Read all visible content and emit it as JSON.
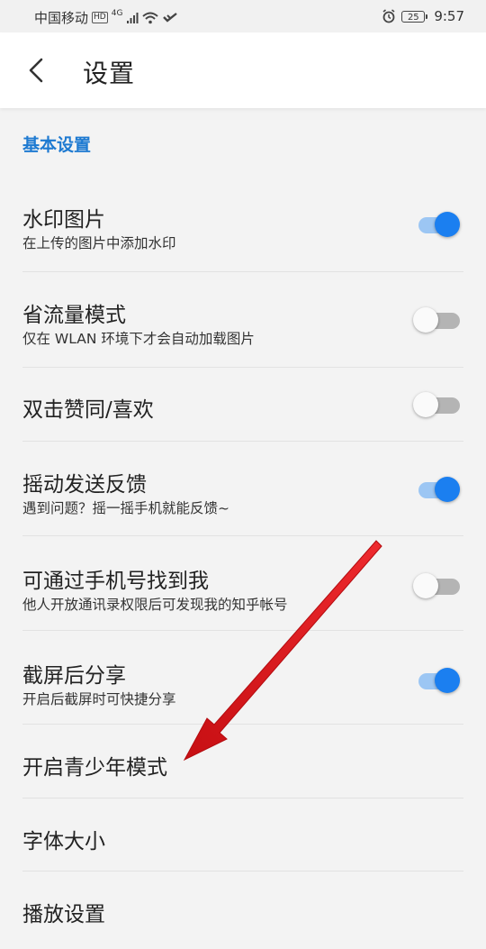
{
  "status_bar": {
    "carrier": "中国移动",
    "hd": "HD",
    "network": "4G",
    "battery": "25",
    "time": "9:57"
  },
  "header": {
    "title": "设置"
  },
  "section": {
    "title": "基本设置"
  },
  "settings": [
    {
      "label": "水印图片",
      "sub": "在上传的图片中添加水印",
      "toggle": "on"
    },
    {
      "label": "省流量模式",
      "sub": "仅在 WLAN 环境下才会自动加载图片",
      "toggle": "off"
    },
    {
      "label": "双击赞同/喜欢",
      "sub": "",
      "toggle": "off"
    },
    {
      "label": "摇动发送反馈",
      "sub": "遇到问题？摇一摇手机就能反馈~",
      "toggle": "on"
    },
    {
      "label": "可通过手机号找到我",
      "sub": "他人开放通讯录权限后可发现我的知乎帐号",
      "toggle": "off"
    },
    {
      "label": "截屏后分享",
      "sub": "开启后截屏时可快捷分享",
      "toggle": "on"
    },
    {
      "label": "开启青少年模式",
      "sub": "",
      "toggle": "none"
    },
    {
      "label": "字体大小",
      "sub": "",
      "toggle": "none"
    },
    {
      "label": "播放设置",
      "sub": "",
      "toggle": "none"
    }
  ],
  "colors": {
    "accent": "#1b7ff0",
    "section_title": "#1e7ad1",
    "annotation_arrow": "#e3161b"
  }
}
